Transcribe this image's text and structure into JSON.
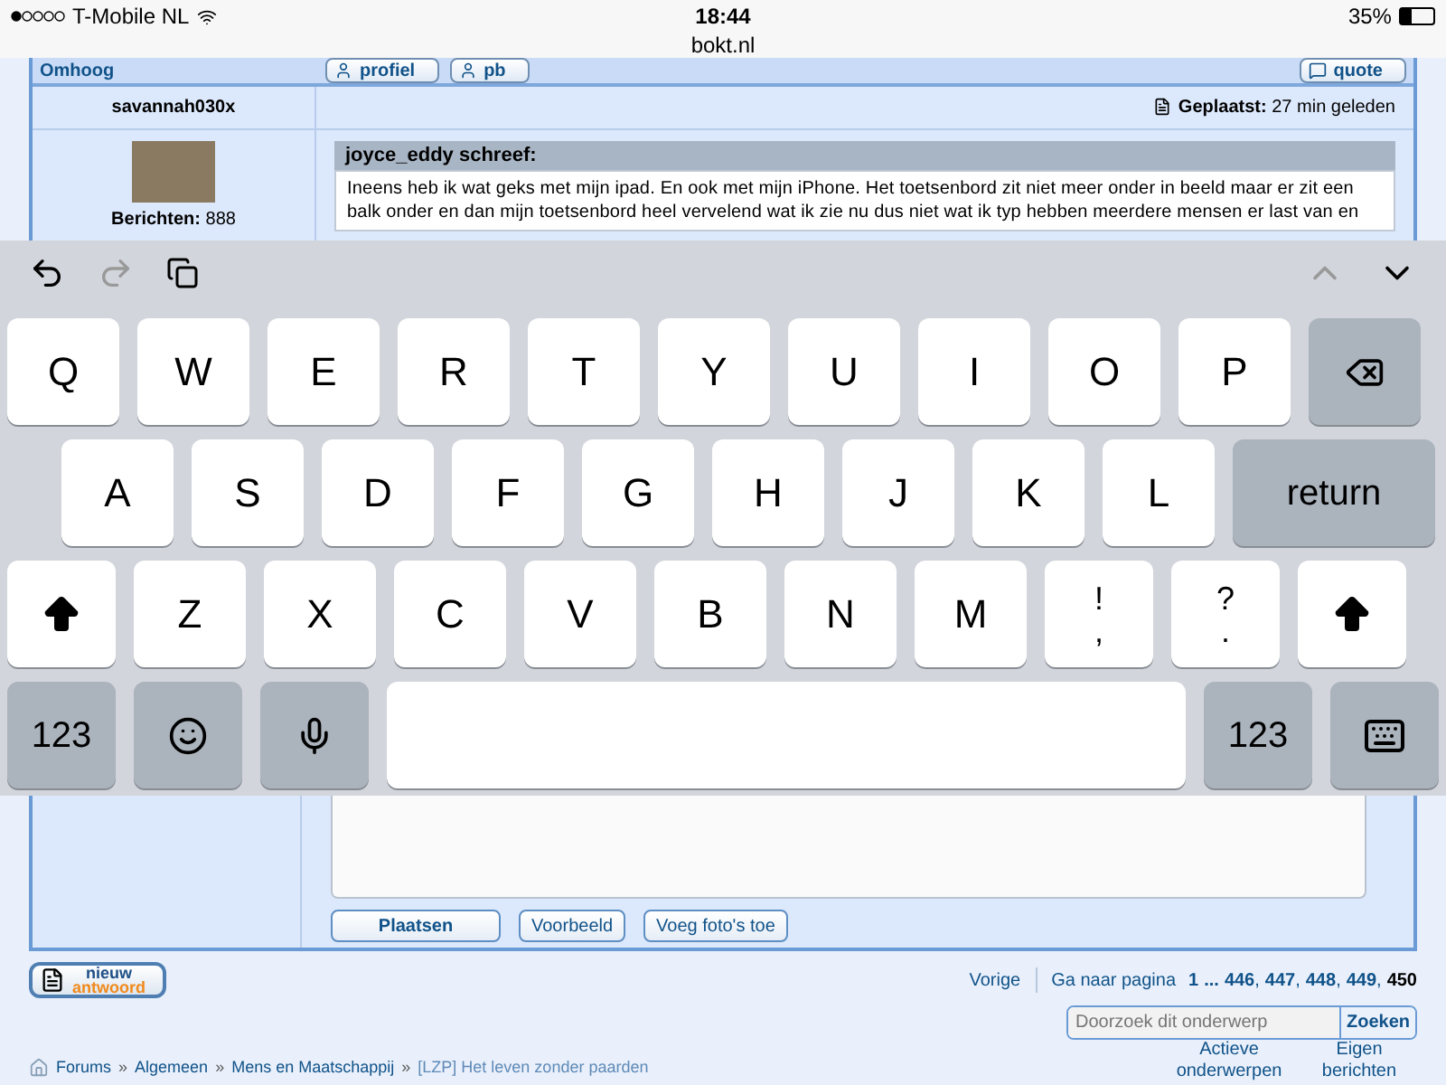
{
  "status_bar": {
    "carrier": "T-Mobile NL",
    "time": "18:44",
    "battery": "35%",
    "url": "bokt.nl"
  },
  "post_bar": {
    "link": "Omhoog",
    "buttons": [
      "profiel",
      "pb"
    ],
    "quote_button": "quote"
  },
  "post": {
    "author": "savannah030x",
    "posted_label": "Geplaatst:",
    "posted_time": "27 min geleden",
    "posts_label": "Berichten:",
    "posts_count": "888",
    "quote_author": "joyce_eddy schreef:",
    "quote_text": "Ineens heb ik wat geks met mijn ipad. En ook met mijn iPhone. Het toetsenbord zit niet meer onder in beeld maar er zit een balk onder en dan mijn toetsenbord heel vervelend wat ik zie nu dus niet wat ik typ hebben meerdere mensen er last van en"
  },
  "keyboard": {
    "rows": [
      [
        {
          "kind": "letter",
          "label": "Q"
        },
        {
          "kind": "letter",
          "label": "W"
        },
        {
          "kind": "letter",
          "label": "E"
        },
        {
          "kind": "letter",
          "label": "R"
        },
        {
          "kind": "letter",
          "label": "T"
        },
        {
          "kind": "letter",
          "label": "Y"
        },
        {
          "kind": "letter",
          "label": "U"
        },
        {
          "kind": "letter",
          "label": "I"
        },
        {
          "kind": "letter",
          "label": "O"
        },
        {
          "kind": "letter",
          "label": "P"
        },
        {
          "kind": "backspace"
        }
      ],
      [
        {
          "kind": "letter",
          "label": "A"
        },
        {
          "kind": "letter",
          "label": "S"
        },
        {
          "kind": "letter",
          "label": "D"
        },
        {
          "kind": "letter",
          "label": "F"
        },
        {
          "kind": "letter",
          "label": "G"
        },
        {
          "kind": "letter",
          "label": "H"
        },
        {
          "kind": "letter",
          "label": "J"
        },
        {
          "kind": "letter",
          "label": "K"
        },
        {
          "kind": "letter",
          "label": "L"
        },
        {
          "kind": "return",
          "label": "return"
        }
      ],
      [
        {
          "kind": "shift"
        },
        {
          "kind": "letter",
          "label": "Z"
        },
        {
          "kind": "letter",
          "label": "X"
        },
        {
          "kind": "letter",
          "label": "C"
        },
        {
          "kind": "letter",
          "label": "V"
        },
        {
          "kind": "letter",
          "label": "B"
        },
        {
          "kind": "letter",
          "label": "N"
        },
        {
          "kind": "letter",
          "label": "M"
        },
        {
          "kind": "dual",
          "label": "!",
          "sub": ","
        },
        {
          "kind": "dual",
          "label": "?",
          "sub": "."
        },
        {
          "kind": "shift"
        }
      ],
      [
        {
          "kind": "mode",
          "label": "123"
        },
        {
          "kind": "emoji"
        },
        {
          "kind": "mic"
        },
        {
          "kind": "space"
        },
        {
          "kind": "mode",
          "label": "123"
        },
        {
          "kind": "hide"
        }
      ]
    ]
  },
  "reply_buttons": [
    {
      "label": "Plaatsen",
      "primary": true
    },
    {
      "label": "Voorbeeld",
      "primary": false
    },
    {
      "label": "Voeg foto's toe",
      "primary": false
    }
  ],
  "new_reply": {
    "top": "nieuw",
    "bottom": "antwoord"
  },
  "pagination": {
    "prev": "Vorige",
    "goto_label": "Ga naar pagina",
    "pages": [
      {
        "label": "1",
        "current": false
      },
      {
        "label": "...",
        "current": false
      },
      {
        "label": "446",
        "current": false,
        "sep": ","
      },
      {
        "label": "447",
        "current": false,
        "sep": ","
      },
      {
        "label": "448",
        "current": false,
        "sep": ","
      },
      {
        "label": "449",
        "current": false,
        "sep": ","
      },
      {
        "label": "450",
        "current": true
      }
    ]
  },
  "search": {
    "placeholder": "Doorzoek dit onderwerp",
    "button": "Zoeken"
  },
  "breadcrumb": [
    {
      "label": "Forums",
      "current": false
    },
    {
      "label": "Algemeen",
      "current": false
    },
    {
      "label": "Mens en Maatschappij",
      "current": false
    },
    {
      "label": "[LZP] Het leven zonder paarden",
      "current": true
    }
  ],
  "breadcrumb_sep": "»",
  "footer_links": [
    "Actieve onderwerpen",
    "Eigen berichten"
  ]
}
